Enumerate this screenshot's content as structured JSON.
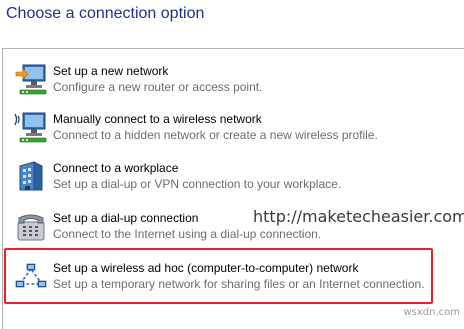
{
  "dialog": {
    "title": "Choose a connection option"
  },
  "options": [
    {
      "icon": "new-network-icon",
      "name": "Set up a new network",
      "description": "Configure a new router or access point."
    },
    {
      "icon": "wireless-network-icon",
      "name": "Manually connect to a wireless network",
      "description": "Connect to a hidden network or create a new wireless profile."
    },
    {
      "icon": "workplace-icon",
      "name": "Connect to a workplace",
      "description": "Set up a dial-up or VPN connection to your workplace."
    },
    {
      "icon": "dialup-phone-icon",
      "name": "Set up a dial-up connection",
      "description": "Connect to the Internet using a dial-up connection."
    },
    {
      "icon": "adhoc-network-icon",
      "name": "Set up a wireless ad hoc (computer-to-computer) network",
      "description": "Set up a temporary network for sharing files or an Internet connection."
    }
  ],
  "watermark": "http://maketecheasier.com",
  "corner_mark": "wsxdn.com",
  "colors": {
    "title": "#1e3287",
    "highlight": "#e8202a",
    "description": "#6d6d6d"
  }
}
